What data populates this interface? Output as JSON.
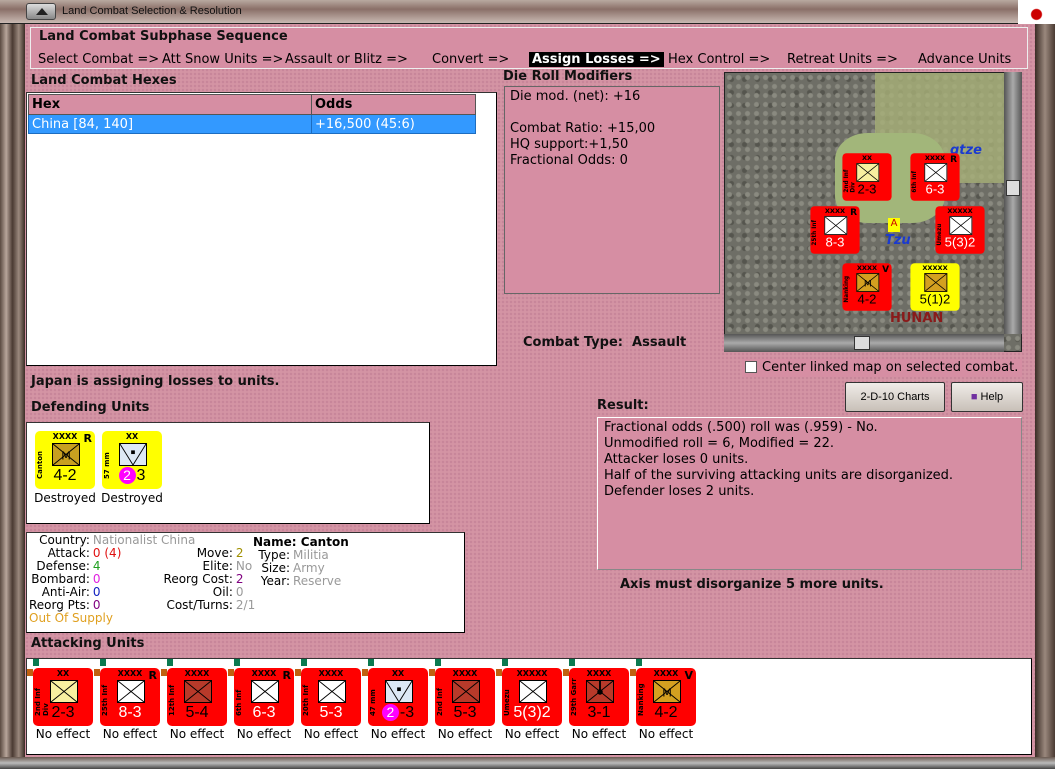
{
  "window": {
    "title": "Land Combat Selection & Resolution"
  },
  "subphase": {
    "title": "Land Combat Subphase Sequence",
    "steps": [
      "Select Combat =>",
      "Att Snow Units =>",
      "Assault or Blitz =>",
      "Convert =>",
      "Assign Losses =>",
      "Hex Control =>",
      "Retreat Units =>",
      "Advance Units"
    ],
    "active": "Assign Losses =>"
  },
  "hexes": {
    "title": "Land Combat Hexes",
    "columns": [
      "Hex",
      "Odds"
    ],
    "rows": [
      {
        "hex": "China [84, 140]",
        "odds": "+16,500 (45:6)"
      }
    ]
  },
  "modifiers": {
    "title": "Die Roll Modifiers",
    "lines": [
      "Die mod. (net): +16",
      "",
      "Combat Ratio: +15,00",
      "HQ support:+1,50",
      "Fractional Odds: 0"
    ]
  },
  "combat_type": {
    "label": "Combat Type:",
    "value": "Assault"
  },
  "map": {
    "labels": [
      "Tzu",
      "HUNAN",
      "gtze"
    ],
    "center_checkbox": {
      "label": "Center linked map on selected combat.",
      "checked": false
    }
  },
  "buttons": {
    "charts": "2-D-10 Charts",
    "help": "Help"
  },
  "status": "Japan is assigning losses to units.",
  "defending": {
    "title": "Defending Units",
    "units": [
      {
        "name": "Canton",
        "size": "XXXX",
        "flag": "R",
        "strength": "4-2",
        "type": "militia",
        "color": "#ffff00",
        "sym": "#c8a020",
        "status": "Destroyed"
      },
      {
        "name": "57 mm",
        "size": "XX",
        "flag": "",
        "strength": "3",
        "badge": "2",
        "type": "artillery",
        "color": "#ffff00",
        "sym": "#dde8f5",
        "status": "Destroyed"
      }
    ]
  },
  "info": {
    "country": {
      "k": "Country:",
      "v": "Nationalist China"
    },
    "attack": {
      "k": "Attack:",
      "v": "0 (4)"
    },
    "defense": {
      "k": "Defense:",
      "v": "4"
    },
    "bombard": {
      "k": "Bombard:",
      "v": "0"
    },
    "antiair": {
      "k": "Anti-Air:",
      "v": "0"
    },
    "reorgpts": {
      "k": "Reorg Pts:",
      "v": "0"
    },
    "move": {
      "k": "Move:",
      "v": "2"
    },
    "elite": {
      "k": "Elite:",
      "v": "No"
    },
    "reorgcost": {
      "k": "Reorg Cost:",
      "v": "2"
    },
    "oil": {
      "k": "Oil:",
      "v": "0"
    },
    "costturns": {
      "k": "Cost/Turns:",
      "v": "2/1"
    },
    "name": "Name: Canton",
    "type": {
      "k": "Type:",
      "v": "Militia"
    },
    "size": {
      "k": "Size:",
      "v": "Army"
    },
    "year": {
      "k": "Year:",
      "v": "Reserve"
    },
    "supply": "Out Of Supply"
  },
  "result": {
    "title": "Result:",
    "lines": [
      "Fractional odds (.500) roll was (.959)  - No.",
      "Unmodified roll = 6, Modified = 22.",
      "Attacker loses 0 units.",
      "Half of the surviving attacking units are disorganized.",
      "Defender loses 2 units."
    ]
  },
  "axis_note": "Axis must disorganize 5 more units.",
  "attacking": {
    "title": "Attacking Units",
    "units": [
      {
        "name": "2nd Inf Div",
        "size": "XX",
        "flag": "",
        "strength": "2-3",
        "sym": "#f8f0a0",
        "text": "#000",
        "status": "No effect"
      },
      {
        "name": "25th Inf",
        "size": "XXXX",
        "flag": "R",
        "strength": "8-3",
        "sym": "#ffffff",
        "text": "#fff",
        "status": "No effect"
      },
      {
        "name": "12th Inf",
        "size": "XXXX",
        "flag": "",
        "strength": "5-4",
        "sym": "#b83a2a",
        "text": "#000",
        "status": "No effect"
      },
      {
        "name": "6th Inf",
        "size": "XXXX",
        "flag": "R",
        "strength": "6-3",
        "sym": "#ffffff",
        "text": "#fff",
        "status": "No effect"
      },
      {
        "name": "20th Inf",
        "size": "XXXX",
        "flag": "",
        "strength": "5-3",
        "sym": "#ffffff",
        "text": "#fff",
        "status": "No effect"
      },
      {
        "name": "47 mm",
        "size": "XX",
        "flag": "",
        "strength": "-3",
        "badge": "2",
        "sym": "#dde8f5",
        "text": "#000",
        "status": "No effect",
        "type": "artillery"
      },
      {
        "name": "2nd Inf",
        "size": "XXXX",
        "flag": "",
        "strength": "5-3",
        "sym": "#b83a2a",
        "text": "#000",
        "status": "No effect"
      },
      {
        "name": "Umezu",
        "size": "XXXXX",
        "flag": "",
        "strength": "5(3)2",
        "sym": "#ffffff",
        "text": "#fff",
        "status": "No effect"
      },
      {
        "name": "29th Garr",
        "size": "XXXX",
        "flag": "",
        "strength": "3-1",
        "sym": "#b83a2a",
        "text": "#000",
        "status": "No effect",
        "type": "garrison"
      },
      {
        "name": "Nanking",
        "size": "XXXX",
        "flag": "V",
        "strength": "4-2",
        "sym": "#d4a020",
        "text": "#000",
        "status": "No effect",
        "type": "militia"
      }
    ]
  },
  "colors": {
    "panel": "#d68ea3",
    "selected": "#3399ff",
    "japan_red": "#ff0000",
    "china_yellow": "#ffff00"
  }
}
